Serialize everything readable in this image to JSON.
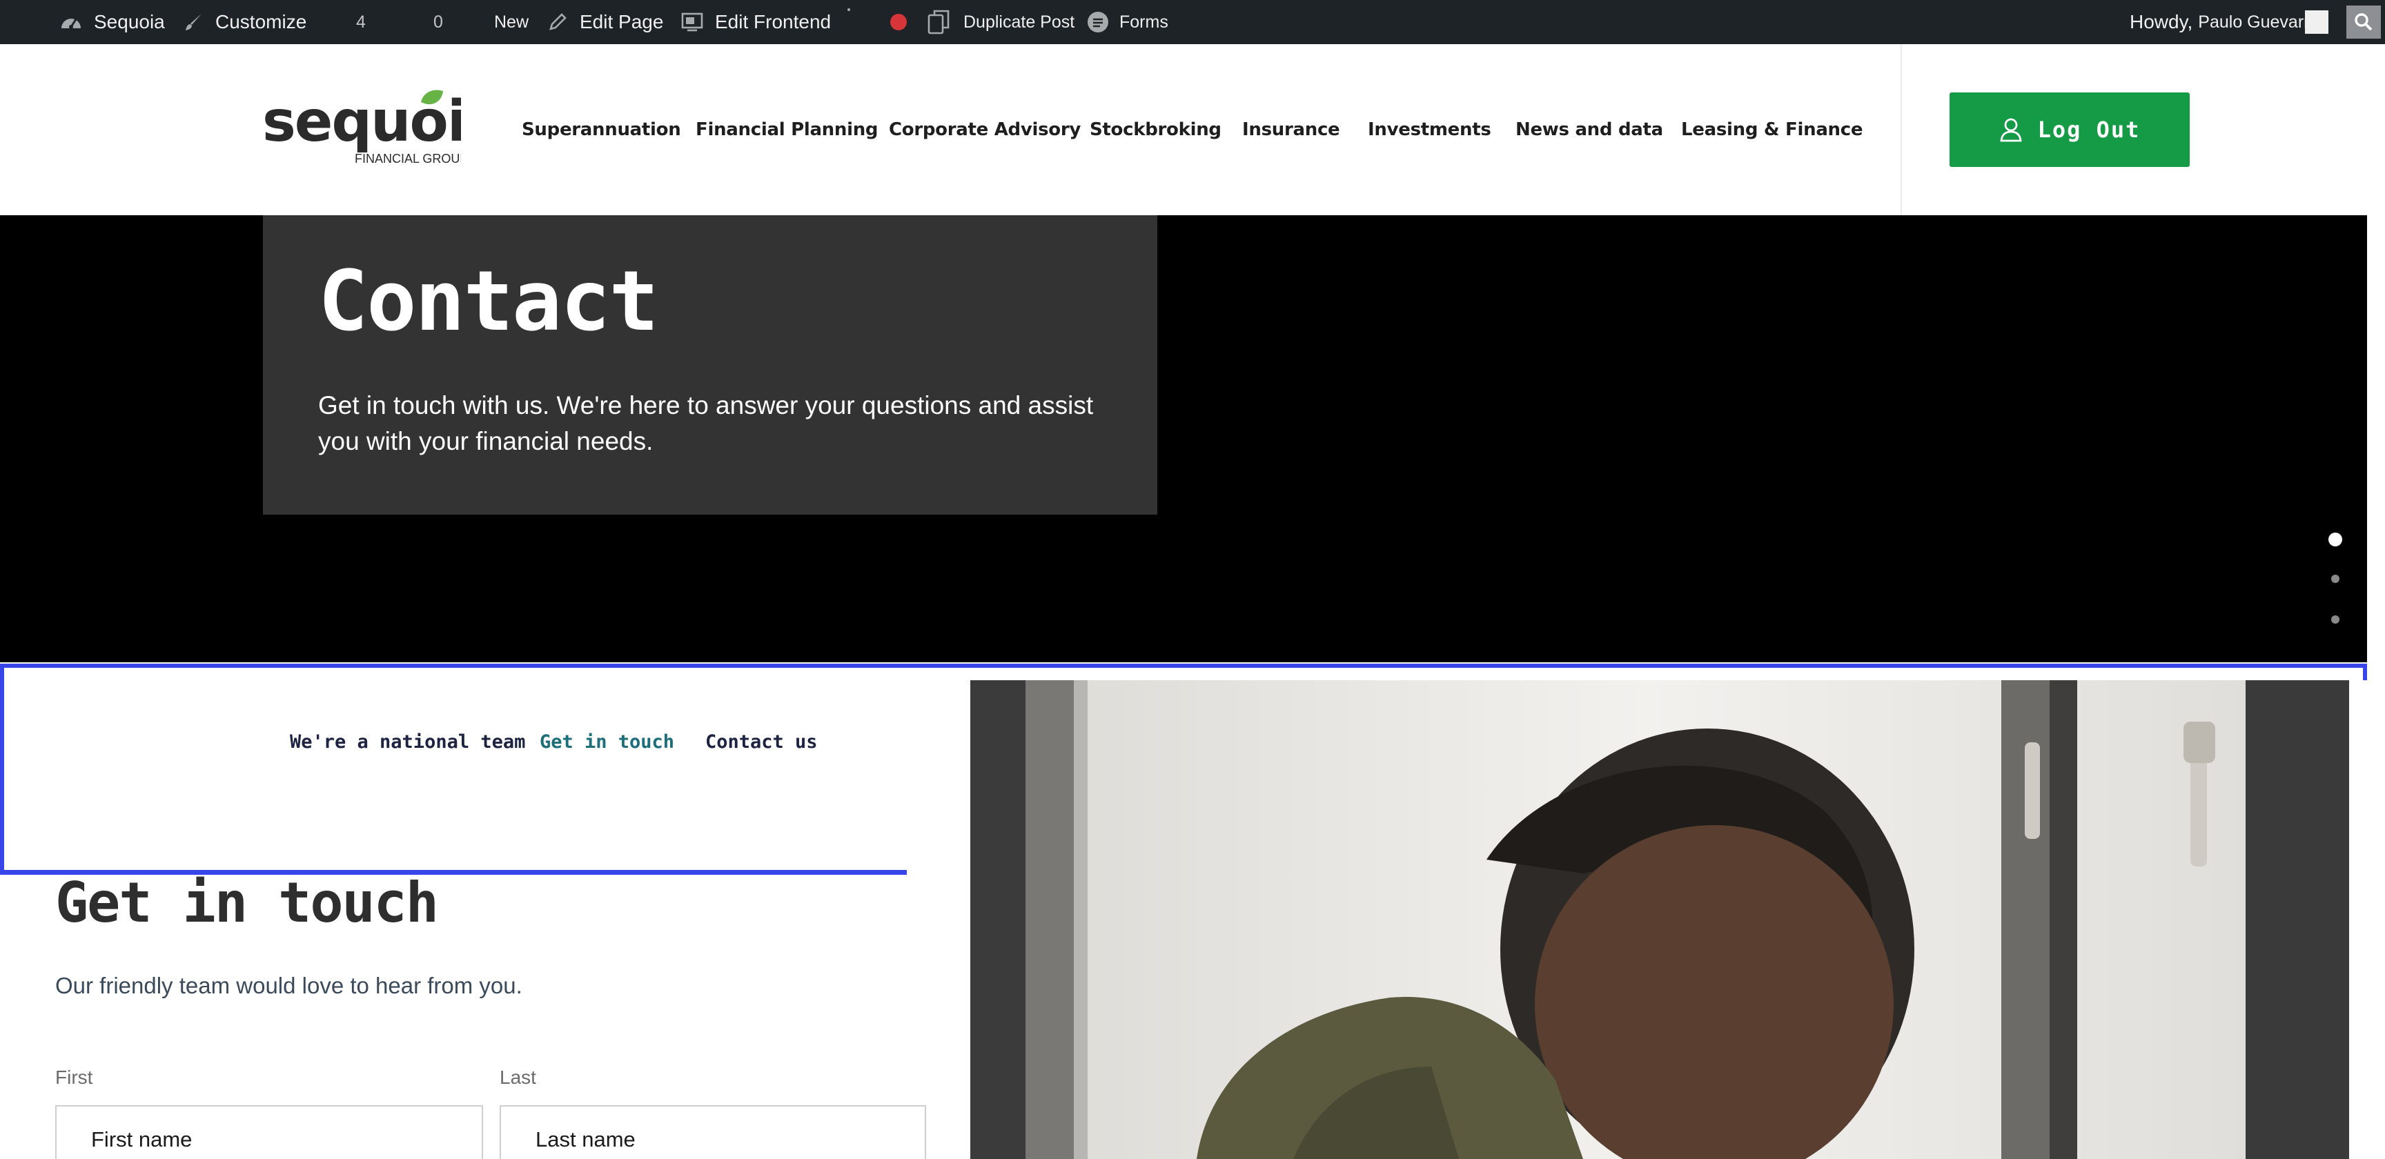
{
  "adminbar": {
    "site_name": "Sequoia",
    "customize": "Customize",
    "updates_count": "4",
    "comments_count": "0",
    "new_label": "New",
    "edit_page": "Edit Page",
    "edit_frontend": "Edit Frontend",
    "duplicate_post": "Duplicate Post",
    "forms": "Forms",
    "howdy": "Howdy,",
    "user_name": "Paulo Guevarra"
  },
  "header": {
    "logo_word": "sequoia",
    "logo_sub": "FINANCIAL GROUP",
    "nav": [
      "Superannuation",
      "Financial Planning",
      "Corporate Advisory",
      "Stockbroking",
      "Insurance",
      "Investments",
      "News and data",
      "Leasing & Finance"
    ],
    "logout_label": "Log Out"
  },
  "hero": {
    "title": "Contact",
    "text": "Get in touch with us. We're here to answer your questions and assist you with your financial needs.",
    "active_slide": 1,
    "slide_count": 3
  },
  "anchors": {
    "items": [
      "We're a national team",
      "Get in touch",
      "Contact us"
    ],
    "active": "Get in touch"
  },
  "form": {
    "title": "Get in touch",
    "subtitle": "Our friendly team would love to hear from you.",
    "first_label": "First",
    "first_placeholder": "First name",
    "last_label": "Last",
    "last_placeholder": "Last name"
  },
  "colors": {
    "adminbar_bg": "#1d2327",
    "brand_green": "#159a45",
    "hero_bg": "#000000",
    "hero_box": "#333333",
    "anchor_border": "#3845e8",
    "active_anchor": "#1b6e7a"
  }
}
